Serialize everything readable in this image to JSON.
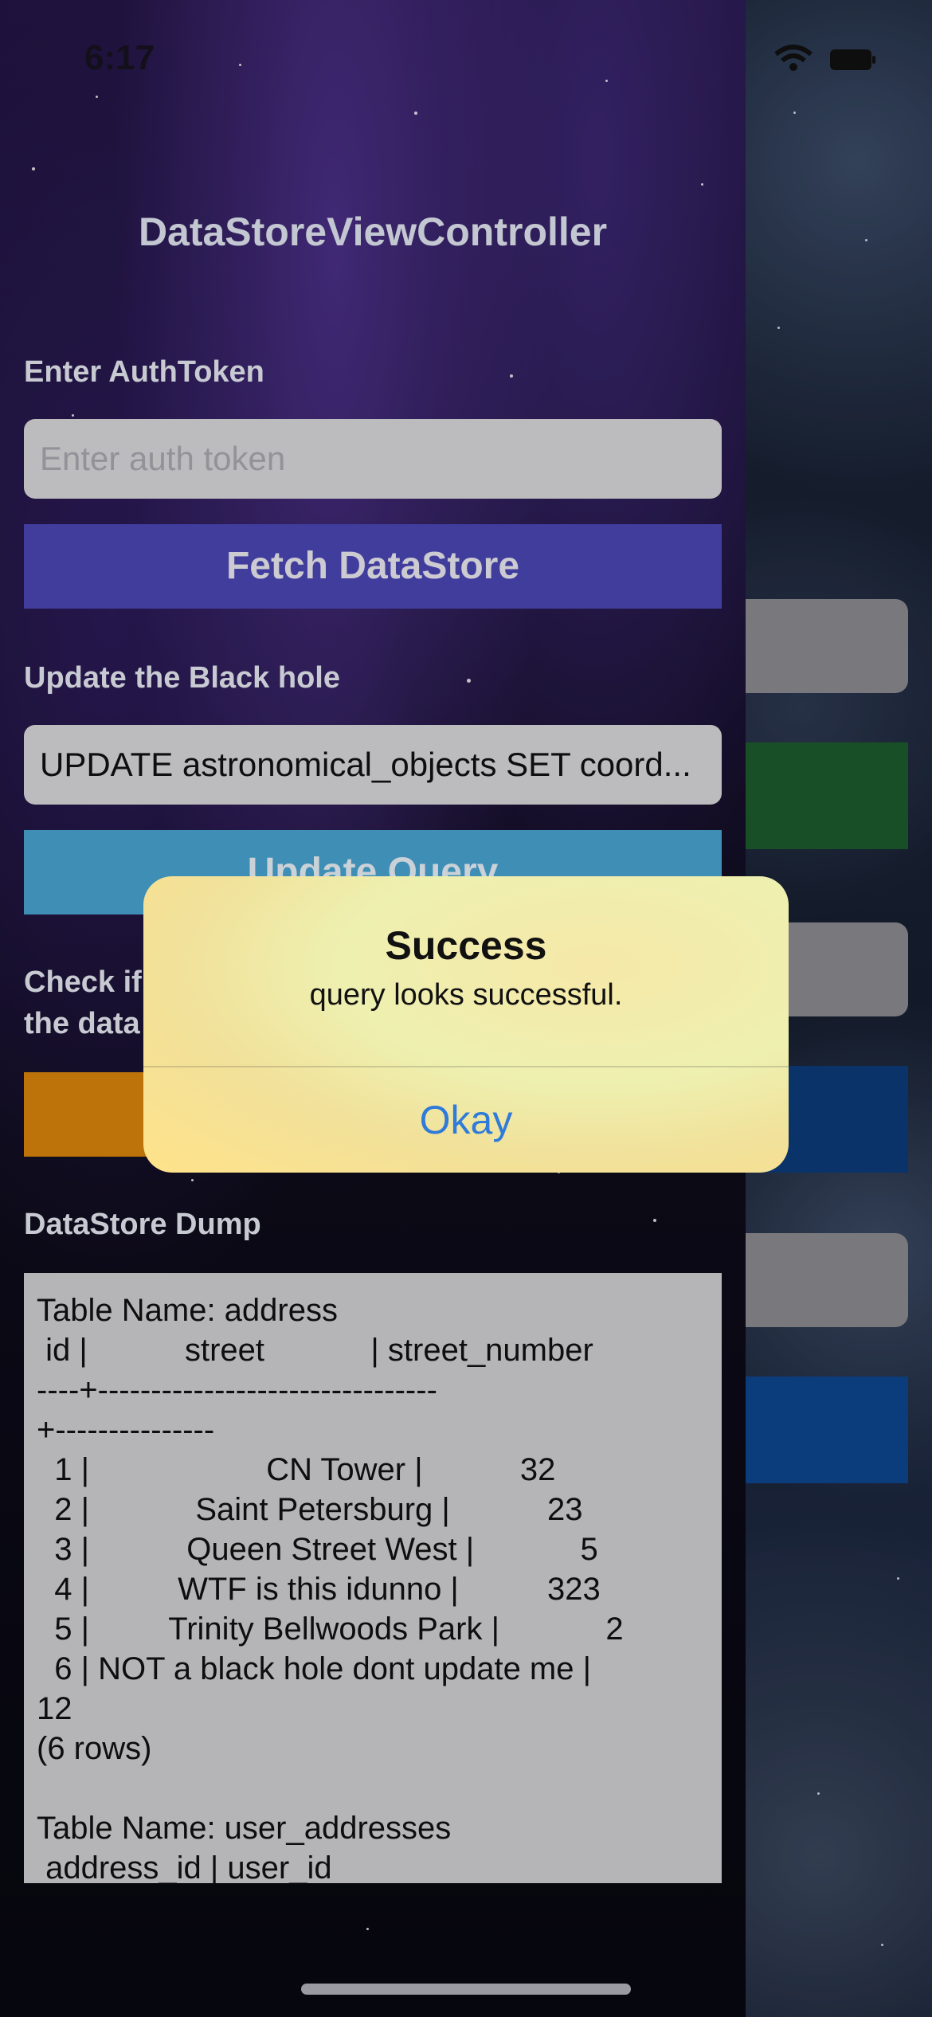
{
  "status_bar": {
    "time": "6:17"
  },
  "screen": {
    "title": "DataStoreViewController",
    "auth": {
      "label": "Enter AuthToken",
      "placeholder": "Enter auth token",
      "value": ""
    },
    "fetch_button": {
      "label": "Fetch DataStore",
      "color": "#4b46b3"
    },
    "update": {
      "label": "Update the Black hole",
      "query_value": "UPDATE astronomical_objects SET coord...",
      "button_label": "Update Query",
      "button_color": "#47a2cf"
    },
    "check": {
      "label_line1": "Check if",
      "label_line2": "the data",
      "button_color": "#d8830b"
    },
    "dump": {
      "label": "DataStore Dump",
      "text": "Table Name: address\n id |           street            | street_number\n----+--------------------------------\n+---------------\n  1 |                    CN Tower |           32\n  2 |            Saint Petersburg |           23\n  3 |           Queen Street West |            5\n  4 |          WTF is this idunno |          323\n  5 |         Trinity Bellwoods Park |            2\n  6 | NOT a black hole dont update me |\n12\n(6 rows)\n\nTable Name: user_addresses\n address_id | user_id"
    }
  },
  "alert": {
    "title": "Success",
    "message": "query looks successful.",
    "button": "Okay"
  },
  "background_blocks": [
    {
      "color": "#8a8a8f"
    },
    {
      "color": "#1d5a2c"
    },
    {
      "color": "#8a8a8f"
    },
    {
      "color": "#0b3b78"
    },
    {
      "color": "#8a8a8f"
    },
    {
      "color": "#0d468f"
    }
  ]
}
